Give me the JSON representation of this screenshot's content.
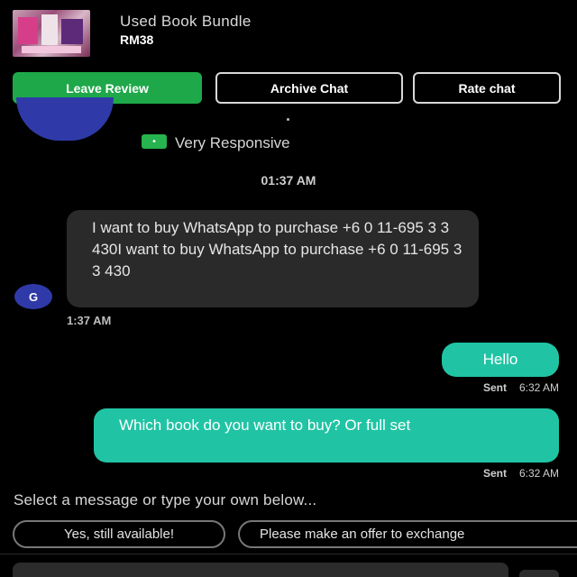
{
  "product": {
    "title": "Used Book Bundle",
    "price": "RM38"
  },
  "actions": {
    "leave_review": "Leave Review",
    "archive_chat": "Archive Chat",
    "rate_chat": "Rate chat"
  },
  "seller": {
    "responsiveness_badge": "Very Responsive",
    "badge_icon": "•",
    "avatar_initial": "G"
  },
  "chat": {
    "date_time": "01:37 AM",
    "incoming": {
      "text": "I want to buy WhatsApp to purchase  +6 0 11-695  3 3 430I want to buy WhatsApp to purchase  +6 0 11-695  3 3 430",
      "time": "1:37 AM"
    },
    "outgoing": [
      {
        "text": "Hello",
        "status": "Sent",
        "time": "6:32 AM"
      },
      {
        "text": "Which book do you want to buy? Or full set",
        "status": "Sent",
        "time": "6:32 AM"
      }
    ]
  },
  "quick_replies": {
    "label": "Select a message or type your own below...",
    "options": [
      "Yes, still available!",
      "Please make an offer to exchange"
    ]
  },
  "colors": {
    "accent_green": "#1fa84a",
    "bubble_outgoing": "#20c4a4",
    "bubble_incoming": "#2a2a2a",
    "avatar_blue": "#2f3aa8"
  }
}
